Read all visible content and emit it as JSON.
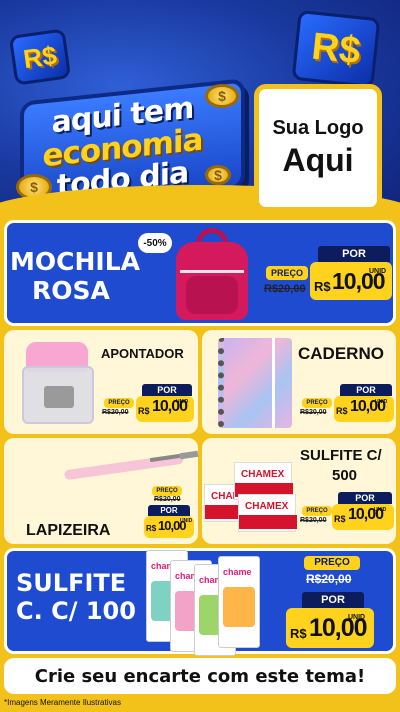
{
  "header": {
    "currency_badges": [
      "R$",
      "R$"
    ],
    "coin_symbol": "$",
    "slogan": [
      "aqui tem",
      "economia",
      "todo dia"
    ],
    "logo_line1": "Sua Logo",
    "logo_line2": "Aqui"
  },
  "products": {
    "mochila": {
      "title_line1": "MOCHILA",
      "title_line2": "ROSA",
      "discount_badge": "-50%",
      "preco_label": "PREÇO",
      "old_price": "R$20,00",
      "por_label": "POR",
      "currency": "R$",
      "price": "10,00",
      "unit": "UNID"
    },
    "apontador": {
      "title": "APONTADOR",
      "preco_label": "PREÇO",
      "old_price": "R$20,00",
      "por_label": "POR",
      "currency": "R$",
      "price": "10,00",
      "unit": "UNID"
    },
    "caderno": {
      "title": "CADERNO",
      "preco_label": "PREÇO",
      "old_price": "R$20,00",
      "por_label": "POR",
      "currency": "R$",
      "price": "10,00",
      "unit": "UNID"
    },
    "lapizeira": {
      "title": "LAPIZEIRA",
      "preco_label": "PREÇO",
      "old_price": "R$20,00",
      "por_label": "POR",
      "currency": "R$",
      "price": "10,00",
      "unit": "UNID"
    },
    "sulfite500": {
      "title_line1": "SULFITE C/",
      "title_line2": "500",
      "ream_brand": "CHAMEX",
      "preco_label": "PREÇO",
      "old_price": "R$20,00",
      "por_label": "POR",
      "currency": "R$",
      "price": "10,00",
      "unit": "UNID"
    },
    "sulfite100": {
      "title_line1": "SULFITE",
      "title_line2": "C. C/ 100",
      "book_brand": "chame",
      "preco_label": "PREÇO",
      "old_price": "R$20,00",
      "por_label": "POR",
      "currency": "R$",
      "price": "10,00",
      "unit": "UNID"
    }
  },
  "footer": {
    "cta": "Crie seu encarte com este tema!",
    "disclaimer": "*Imagens Meramente Ilustrativas"
  },
  "colors": {
    "background": "#f3c21a",
    "card_blue": "#1f4bd1",
    "card_cream": "#fff7d8",
    "navy": "#0c1c5c",
    "price_yellow": "#ffd21e"
  }
}
